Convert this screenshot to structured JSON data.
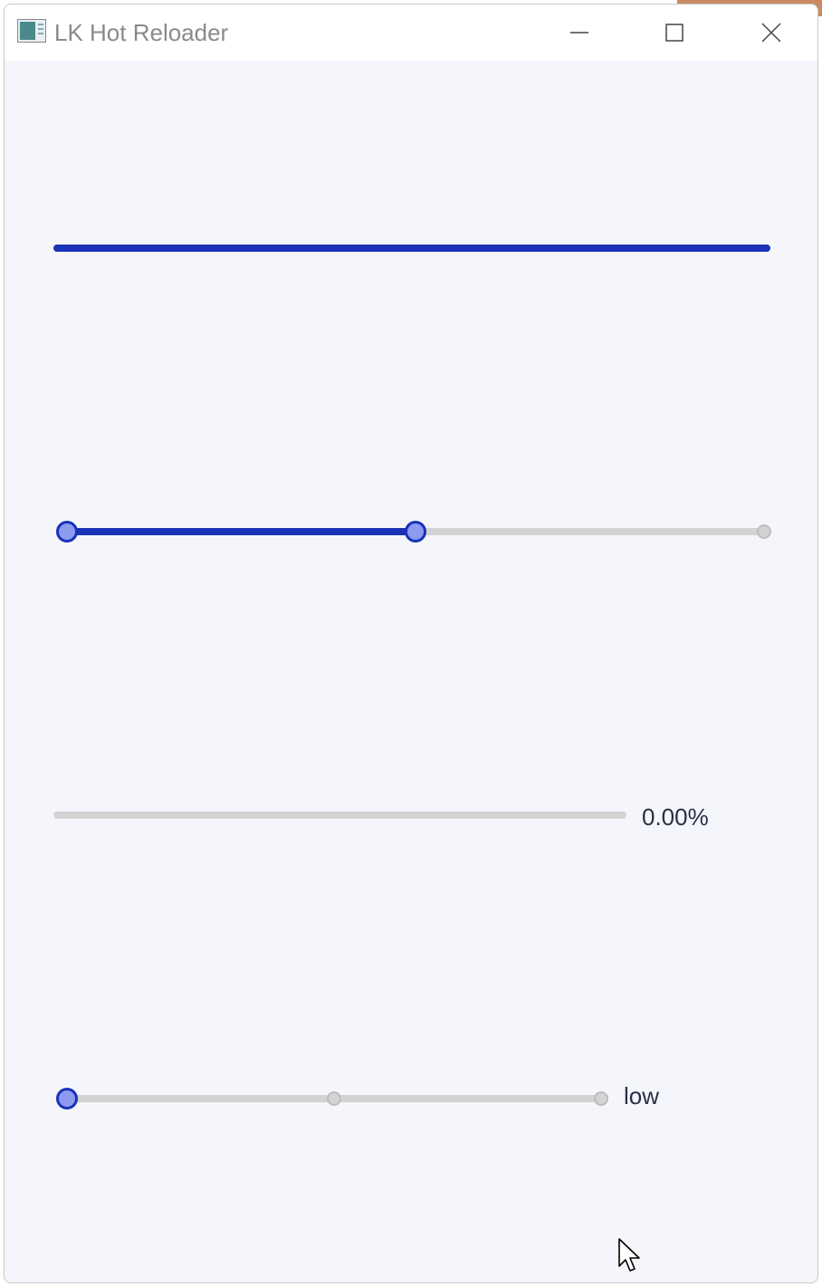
{
  "window": {
    "title": "LK Hot Reloader",
    "icons": {
      "app": "app-window-icon",
      "minimize": "minimize-icon",
      "maximize": "maximize-icon",
      "close": "close-icon"
    }
  },
  "colors": {
    "accent": "#1a32b8",
    "thumb_fill": "#8c9bf0",
    "track": "#d3d3d3",
    "background": "#f4f6fb",
    "text": "#2a2f45"
  },
  "sliders": [
    {
      "id": "full-slider",
      "fraction": 1.0,
      "value_text": ""
    },
    {
      "id": "range-slider",
      "range_start": 0.0,
      "range_end": 0.5,
      "ticks": [
        1.0
      ],
      "value_text": ""
    },
    {
      "id": "percent-slider",
      "fraction": 0.0,
      "value_text": "0.00%"
    },
    {
      "id": "level-slider",
      "fraction": 0.0,
      "ticks": [
        0.5,
        1.0
      ],
      "value_text": "low"
    }
  ]
}
